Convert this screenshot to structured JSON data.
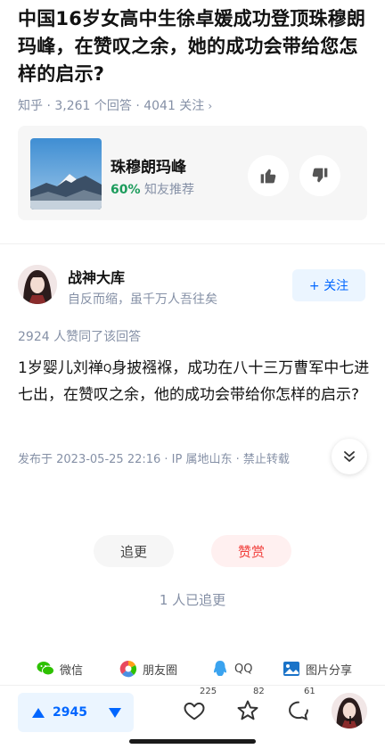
{
  "question": {
    "title": "中国16岁女高中生徐卓媛成功登顶珠穆朗玛峰，在赞叹之余，她的成功会带给您怎样的启示?",
    "meta": "知乎 · 3,261 个回答 · 4041 关注",
    "meta_chevron": "›"
  },
  "topic": {
    "name": "珠穆朗玛峰",
    "recommend_pct": "60%",
    "recommend_text": "知友推荐"
  },
  "author": {
    "name": "战神大库",
    "bio": "自反而缩，虽千万人吾往矣",
    "follow_label": "+ 关注"
  },
  "answer": {
    "agree_text": "2924 人赞同了该回答",
    "body_part1": "1岁婴儿刘禅",
    "search_mark": "Q",
    "body_part2": "身披襁褓，成功在八十三万曹军中七进七出，在赞叹之余，他的成功会带给你怎样的启示?",
    "published": "发布于 2023-05-25 22:16 · IP 属地山东 · 禁止转载"
  },
  "actions": {
    "follow_up_label": "追更",
    "tip_label": "赞赏",
    "followers_text": "1 人已追更"
  },
  "share": [
    {
      "label": "微信",
      "icon": "wechat-icon"
    },
    {
      "label": "朋友圈",
      "icon": "moments-icon"
    },
    {
      "label": "QQ",
      "icon": "qq-icon"
    },
    {
      "label": "图片分享",
      "icon": "image-share-icon"
    }
  ],
  "bottom_bar": {
    "vote_count": "2945",
    "like_count": "225",
    "favorite_count": "82",
    "comment_count": "61",
    "avatar_plus": "+"
  },
  "colors": {
    "accent": "#0066ff",
    "tip": "#f1403c",
    "meta": "#8590a6",
    "recommend": "#1c9c5c"
  }
}
